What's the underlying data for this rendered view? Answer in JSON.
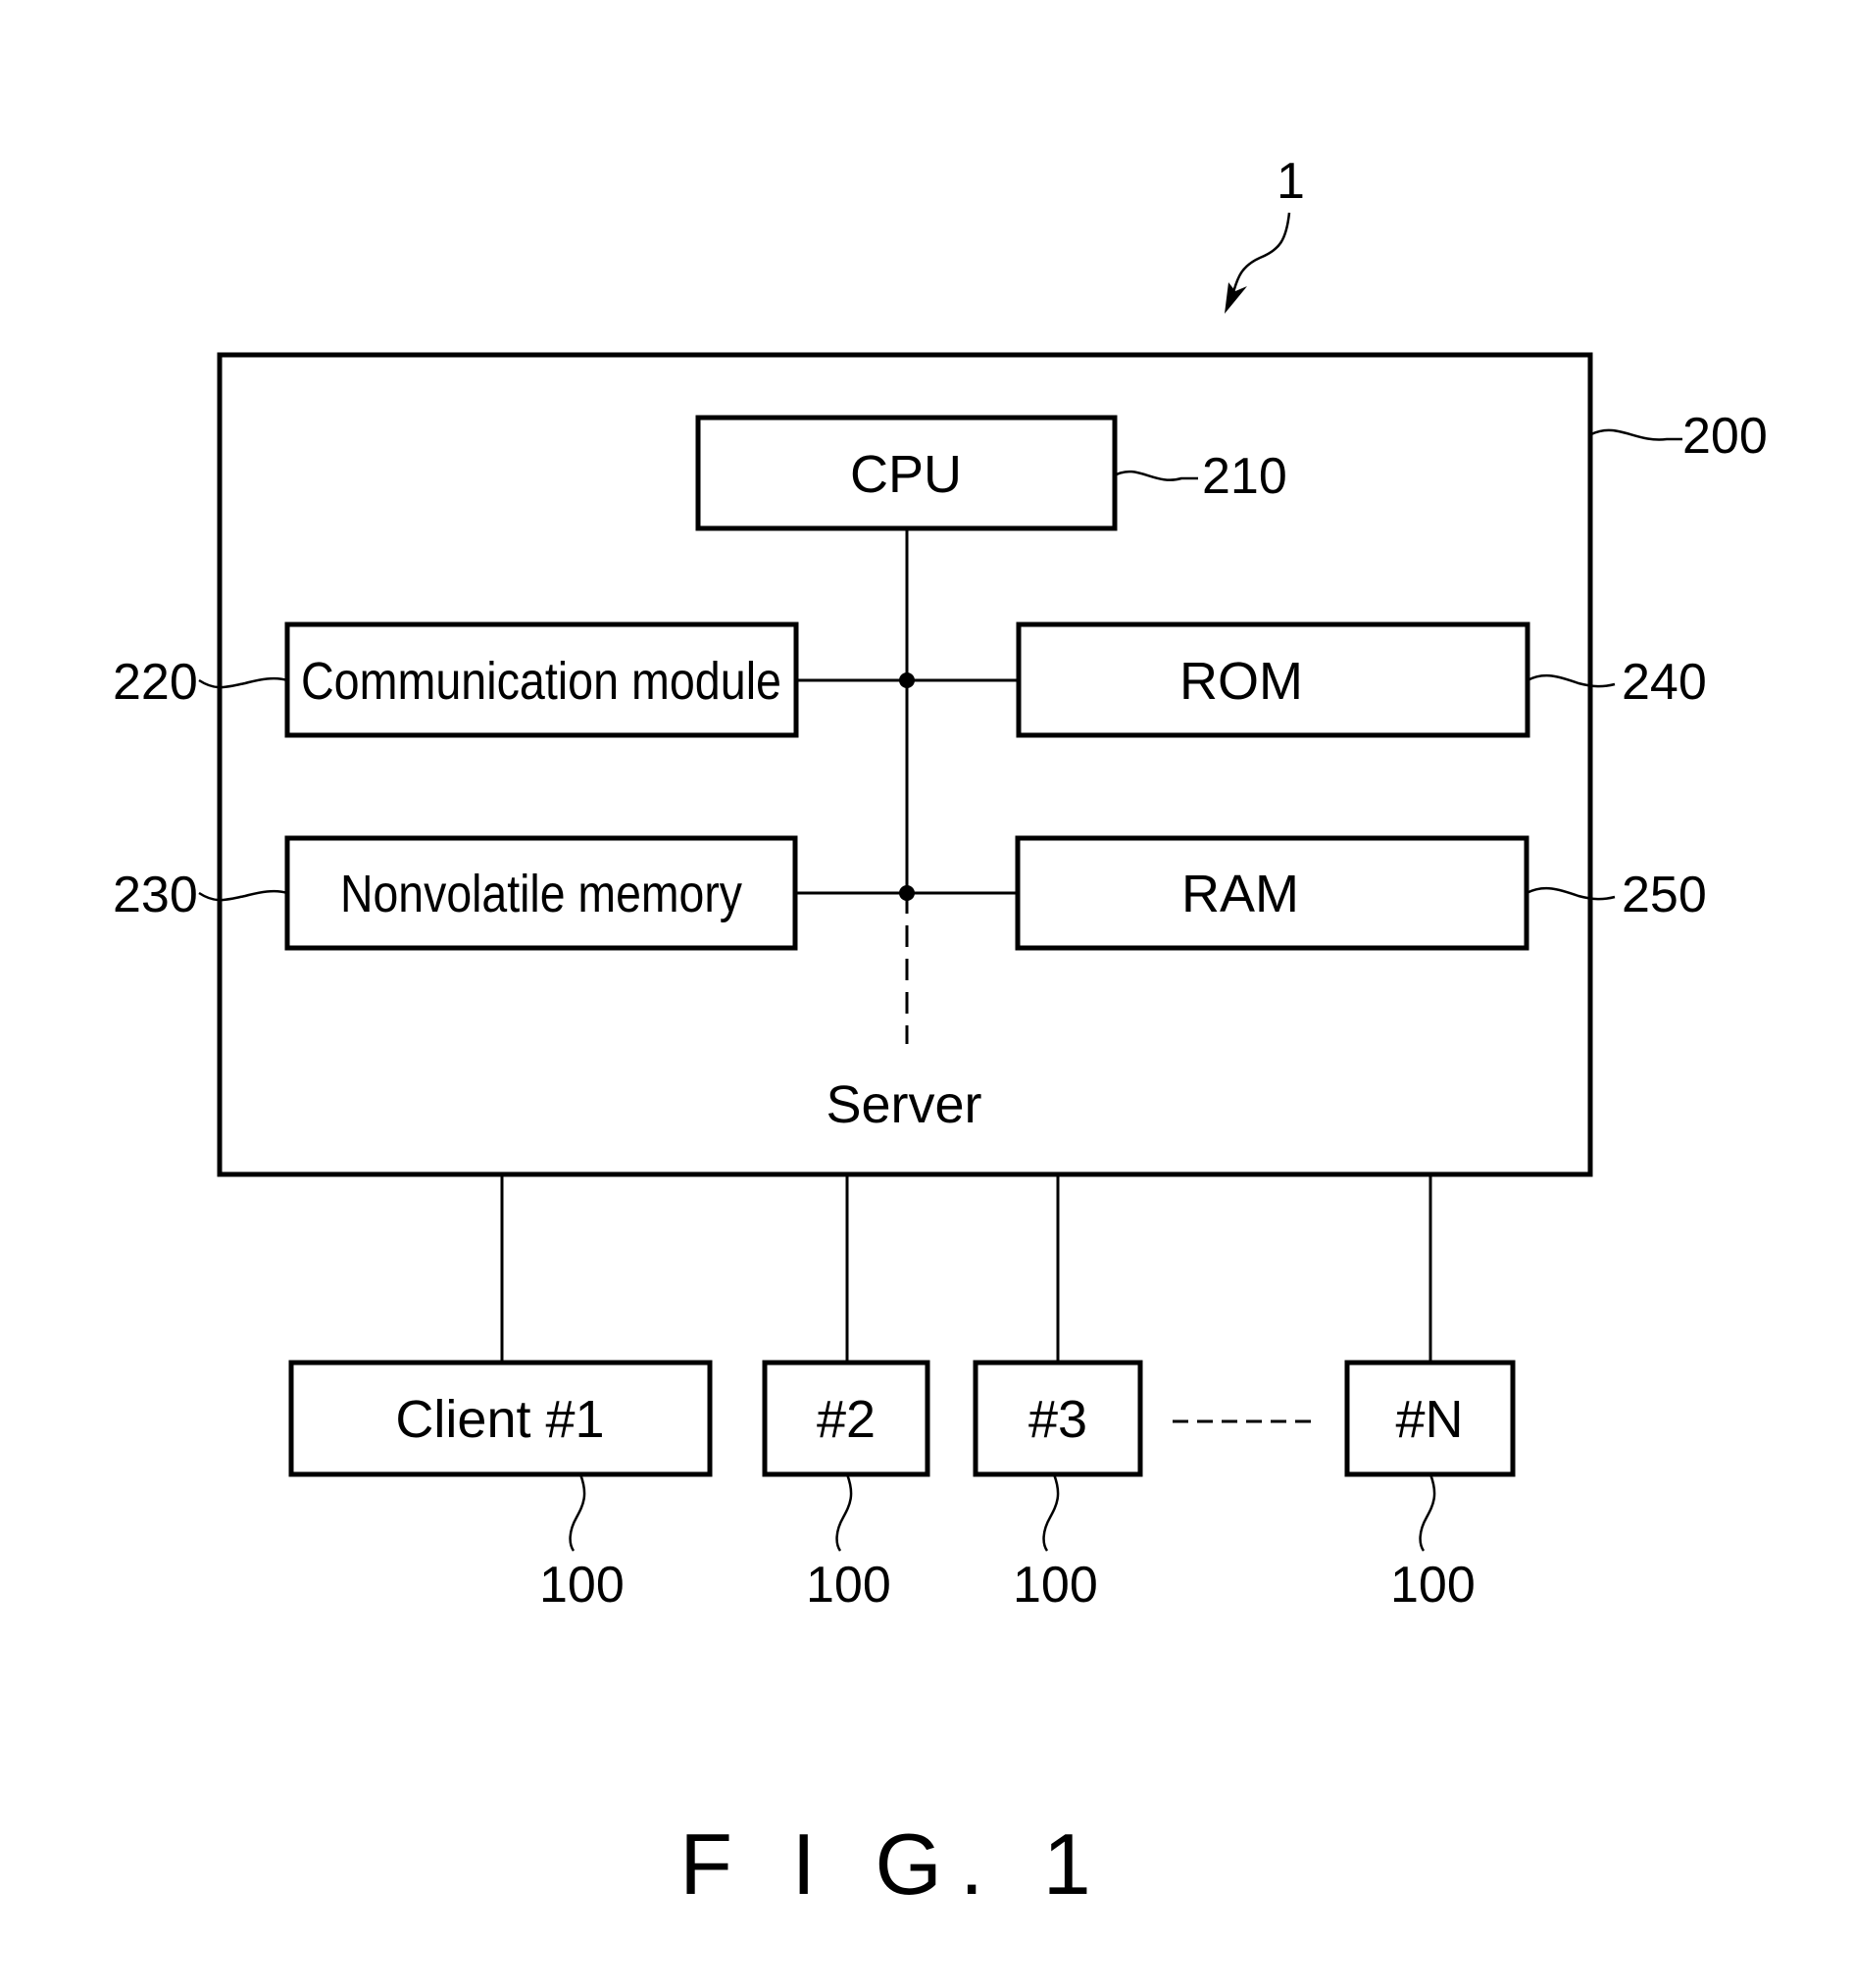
{
  "figure": {
    "title": "F I G. 1",
    "system_ref": "1"
  },
  "server": {
    "label": "Server",
    "ref": "200",
    "components": {
      "cpu": {
        "label": "CPU",
        "ref": "210"
      },
      "comm": {
        "label": "Communication module",
        "ref": "220"
      },
      "nvmem": {
        "label": "Nonvolatile memory",
        "ref": "230"
      },
      "rom": {
        "label": "ROM",
        "ref": "240"
      },
      "ram": {
        "label": "RAM",
        "ref": "250"
      }
    }
  },
  "clients": [
    {
      "label": "Client #1",
      "ref": "100"
    },
    {
      "label": "#2",
      "ref": "100"
    },
    {
      "label": "#3",
      "ref": "100"
    },
    {
      "label": "#N",
      "ref": "100"
    }
  ]
}
